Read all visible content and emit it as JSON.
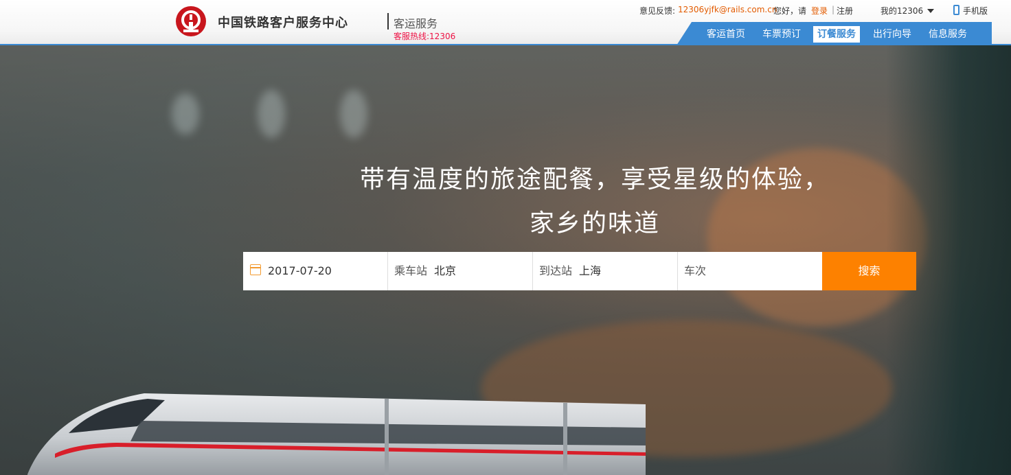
{
  "header": {
    "brand": "中国铁路客户服务中心",
    "subbrand": "客运服务",
    "hotline": "客服热线:12306",
    "feedback_label": "意见反馈:",
    "feedback_email": "12306yjfk@rails.com.cn",
    "greeting": "您好，请",
    "login": "登录",
    "separator": "|",
    "register": "注册",
    "my12306": "我的12306",
    "mobile": "手机版"
  },
  "nav": {
    "items": [
      {
        "label": "客运首页"
      },
      {
        "label": "车票预订"
      },
      {
        "label": "订餐服务"
      },
      {
        "label": "出行向导"
      },
      {
        "label": "信息服务"
      }
    ],
    "active": "订餐服务"
  },
  "hero": {
    "line1": "带有温度的旅途配餐，享受星级的体验，",
    "line2": "家乡的味道"
  },
  "search": {
    "date": "2017-07-20",
    "from_label": "乘车站",
    "from_value": "北京",
    "to_label": "到达站",
    "to_value": "上海",
    "train_label": "车次",
    "button": "搜索"
  },
  "colors": {
    "nav_blue": "#3b8ad3",
    "search_orange": "#fd8100",
    "accent_orange": "#e35b00",
    "hotline_red": "#e14"
  }
}
